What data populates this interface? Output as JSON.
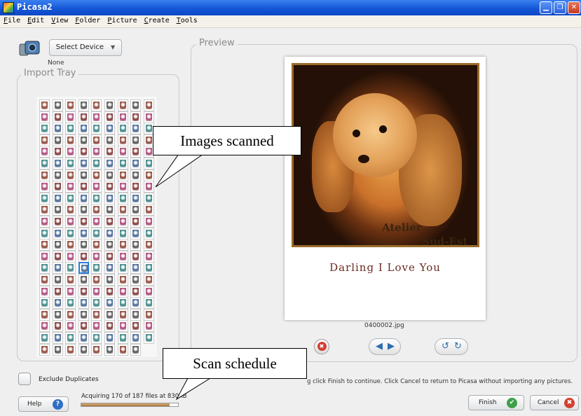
{
  "window": {
    "title": "Picasa2"
  },
  "menu": [
    "File",
    "Edit",
    "View",
    "Folder",
    "Picture",
    "Create",
    "Tools"
  ],
  "device": {
    "button_label": "Select Device",
    "status": "None"
  },
  "import_tray": {
    "legend": "Import Tray"
  },
  "preview": {
    "legend": "Preview",
    "photo_watermark_line1": "Atelier",
    "photo_watermark_line2": "Sud-Est",
    "photo_caption": "Darling I Love You",
    "filename": "0400002.jpg"
  },
  "controls": {
    "exclude_duplicates_label": "Exclude Duplicates"
  },
  "instructions": "g click Finish to continue. Click Cancel to return to Picasa without importing any pictures.",
  "progress": {
    "text": "Acquiring 170 of 187 files at 830KB",
    "value": 0.91
  },
  "buttons": {
    "help": "Help",
    "finish": "Finish",
    "cancel": "Cancel"
  },
  "annotations": {
    "images_scanned": "Images scanned",
    "scan_schedule": "Scan schedule"
  },
  "colors": {
    "accent": "#2b7bd6",
    "finish_icon": "#3fa14a",
    "cancel_icon": "#d4402f",
    "help_icon": "#2f6fc4"
  }
}
